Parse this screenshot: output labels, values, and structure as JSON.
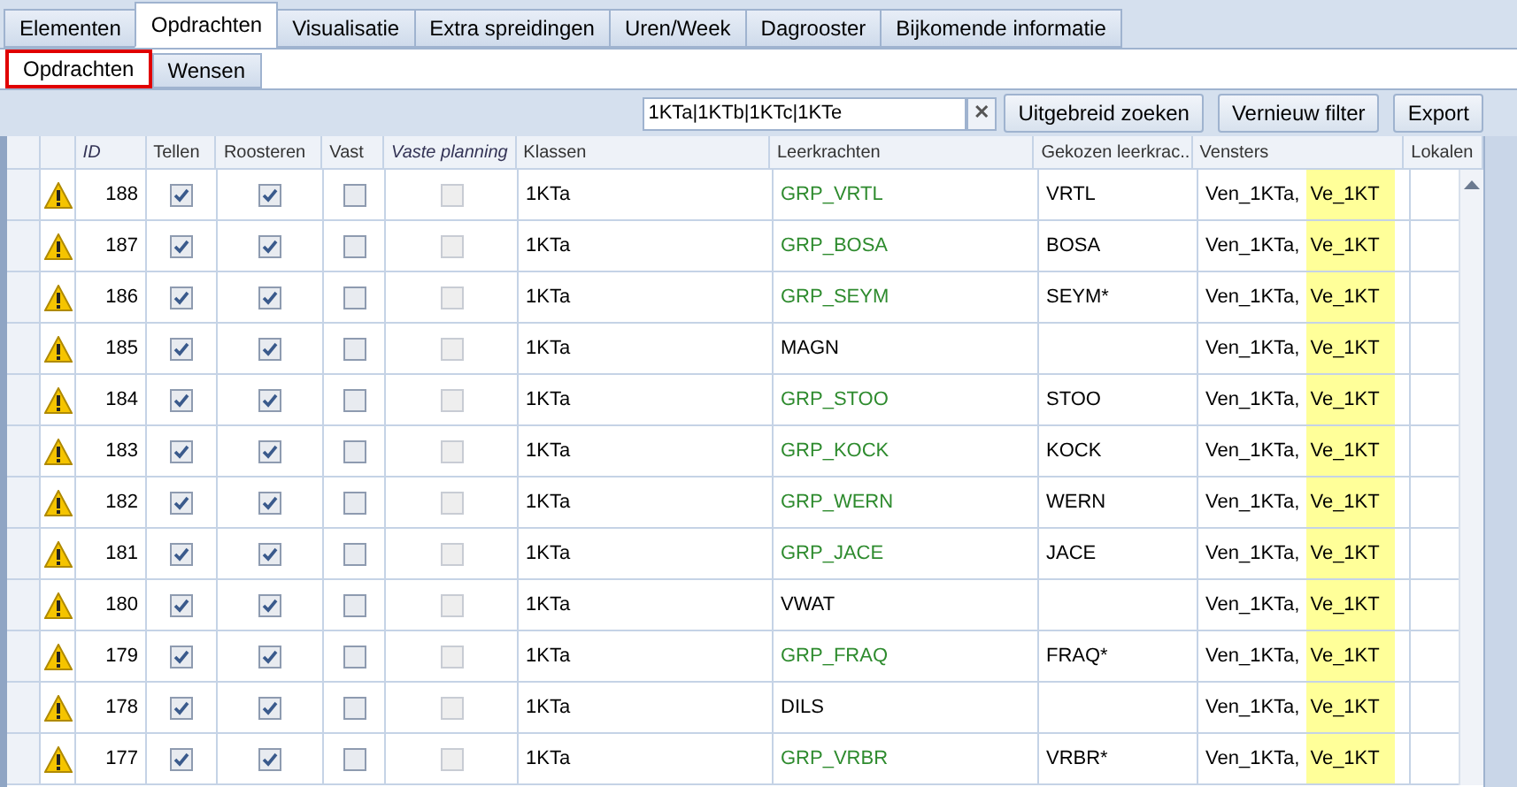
{
  "tabs": [
    {
      "label": "Elementen",
      "selected": false
    },
    {
      "label": "Opdrachten",
      "selected": true
    },
    {
      "label": "Visualisatie",
      "selected": false
    },
    {
      "label": "Extra spreidingen",
      "selected": false
    },
    {
      "label": "Uren/Week",
      "selected": false
    },
    {
      "label": "Dagrooster",
      "selected": false
    },
    {
      "label": "Bijkomende informatie",
      "selected": false
    }
  ],
  "subtabs": [
    {
      "label": "Opdrachten",
      "selected": true
    },
    {
      "label": "Wensen",
      "selected": false
    }
  ],
  "filter": {
    "value": "1KTa|1KTb|1KTc|1KTe",
    "clear": "✕"
  },
  "buttons": [
    "Uitgebreid zoeken",
    "Vernieuw filter",
    "Export"
  ],
  "table": {
    "columns": [
      {
        "label": "ID",
        "italic": true
      },
      {
        "label": "Tellen",
        "italic": false
      },
      {
        "label": "Roosteren",
        "italic": false
      },
      {
        "label": "Vast",
        "italic": false
      },
      {
        "label": "Vaste planning",
        "italic": true
      },
      {
        "label": "Klassen",
        "italic": false
      },
      {
        "label": "Leerkrachten",
        "italic": false
      },
      {
        "label": "Gekozen leerkrac...",
        "italic": false
      },
      {
        "label": "Vensters",
        "italic": false
      },
      {
        "label": "Lokalen",
        "italic": false
      }
    ],
    "rows": [
      {
        "id": "188",
        "tellen": true,
        "roosteren": true,
        "vast": false,
        "vaste_planning": false,
        "klassen": "1KTa",
        "leerkracht": {
          "text": "GRP_VRTL",
          "color": "#2e8b2e"
        },
        "gekozen": "VRTL",
        "vensters": [
          {
            "text": "Ven_1KTa,",
            "highlighted": false
          },
          {
            "text": "Ve_1KT",
            "highlighted": true
          }
        ]
      },
      {
        "id": "187",
        "tellen": true,
        "roosteren": true,
        "vast": false,
        "vaste_planning": false,
        "klassen": "1KTa",
        "leerkracht": {
          "text": "GRP_BOSA",
          "color": "#2e8b2e"
        },
        "gekozen": "BOSA",
        "vensters": [
          {
            "text": "Ven_1KTa,",
            "highlighted": false
          },
          {
            "text": "Ve_1KT",
            "highlighted": true
          }
        ]
      },
      {
        "id": "186",
        "tellen": true,
        "roosteren": true,
        "vast": false,
        "vaste_planning": false,
        "klassen": "1KTa",
        "leerkracht": {
          "text": "GRP_SEYM",
          "color": "#2e8b2e"
        },
        "gekozen": "SEYM*",
        "vensters": [
          {
            "text": "Ven_1KTa,",
            "highlighted": false
          },
          {
            "text": "Ve_1KT",
            "highlighted": true
          }
        ]
      },
      {
        "id": "185",
        "tellen": true,
        "roosteren": true,
        "vast": false,
        "vaste_planning": false,
        "klassen": "1KTa",
        "leerkracht": {
          "text": "MAGN",
          "color": "#000000"
        },
        "vensters": [
          {
            "text": "Ven_1KTa,",
            "highlighted": false
          },
          {
            "text": "Ve_1KT",
            "highlighted": true
          }
        ]
      },
      {
        "id": "184",
        "tellen": true,
        "roosteren": true,
        "vast": false,
        "vaste_planning": false,
        "klassen": "1KTa",
        "leerkracht": {
          "text": "GRP_STOO",
          "color": "#2e8b2e"
        },
        "gekozen": "STOO",
        "vensters": [
          {
            "text": "Ven_1KTa,",
            "highlighted": false
          },
          {
            "text": "Ve_1KT",
            "highlighted": true
          }
        ]
      },
      {
        "id": "183",
        "tellen": true,
        "roosteren": true,
        "vast": false,
        "vaste_planning": false,
        "klassen": "1KTa",
        "leerkracht": {
          "text": "GRP_KOCK",
          "color": "#2e8b2e"
        },
        "gekozen": "KOCK",
        "vensters": [
          {
            "text": "Ven_1KTa,",
            "highlighted": false
          },
          {
            "text": "Ve_1KT",
            "highlighted": true
          }
        ]
      },
      {
        "id": "182",
        "tellen": true,
        "roosteren": true,
        "vast": false,
        "vaste_planning": false,
        "klassen": "1KTa",
        "leerkracht": {
          "text": "GRP_WERN",
          "color": "#2e8b2e"
        },
        "gekozen": "WERN",
        "vensters": [
          {
            "text": "Ven_1KTa,",
            "highlighted": false
          },
          {
            "text": "Ve_1KT",
            "highlighted": true
          }
        ]
      },
      {
        "id": "181",
        "tellen": true,
        "roosteren": true,
        "vast": false,
        "vaste_planning": false,
        "klassen": "1KTa",
        "leerkracht": {
          "text": "GRP_JACE",
          "color": "#2e8b2e"
        },
        "gekozen": "JACE",
        "vensters": [
          {
            "text": "Ven_1KTa,",
            "highlighted": false
          },
          {
            "text": "Ve_1KT",
            "highlighted": true
          }
        ]
      },
      {
        "id": "180",
        "tellen": true,
        "roosteren": true,
        "vast": false,
        "vaste_planning": false,
        "klassen": "1KTa",
        "leerkracht": {
          "text": "VWAT",
          "color": "#000000"
        },
        "vensters": [
          {
            "text": "Ven_1KTa,",
            "highlighted": false
          },
          {
            "text": "Ve_1KT",
            "highlighted": true
          }
        ]
      },
      {
        "id": "179",
        "tellen": true,
        "roosteren": true,
        "vast": false,
        "vaste_planning": false,
        "klassen": "1KTa",
        "leerkracht": {
          "text": "GRP_FRAQ",
          "color": "#2e8b2e"
        },
        "gekozen": "FRAQ*",
        "vensters": [
          {
            "text": "Ven_1KTa,",
            "highlighted": false
          },
          {
            "text": "Ve_1KT",
            "highlighted": true
          }
        ]
      },
      {
        "id": "178",
        "tellen": true,
        "roosteren": true,
        "vast": false,
        "vaste_planning": false,
        "klassen": "1KTa",
        "leerkracht": {
          "text": "DILS",
          "color": "#000000"
        },
        "vensters": [
          {
            "text": "Ven_1KTa,",
            "highlighted": false
          },
          {
            "text": "Ve_1KT",
            "highlighted": true
          }
        ]
      },
      {
        "id": "177",
        "tellen": true,
        "roosteren": true,
        "vast": false,
        "vaste_planning": false,
        "klassen": "1KTa",
        "leerkracht": {
          "text": "GRP_VRBR",
          "color": "#2e8b2e"
        },
        "gekozen": "VRBR*",
        "vensters": [
          {
            "text": "Ven_1KTa,",
            "highlighted": false
          },
          {
            "text": "Ve_1KT",
            "highlighted": true
          }
        ]
      }
    ]
  }
}
